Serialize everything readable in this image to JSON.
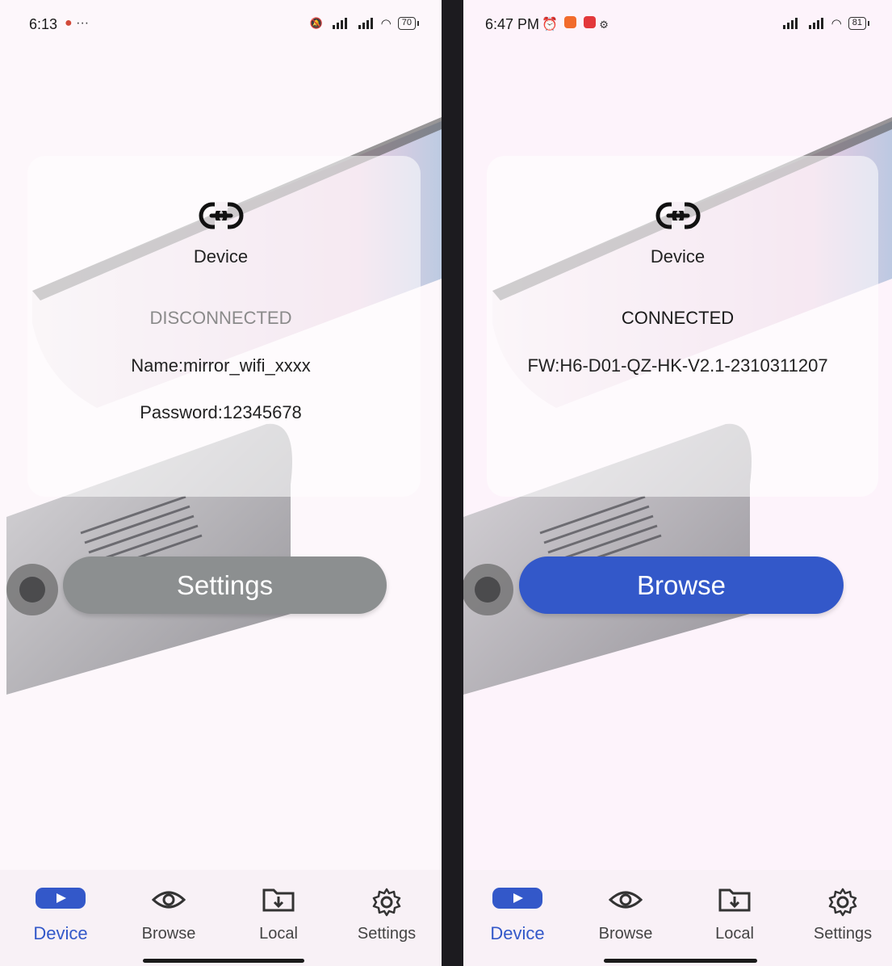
{
  "screens": [
    {
      "status_bar": {
        "time": "6:13",
        "extra": "···",
        "battery": "70"
      },
      "device": {
        "title": "Device",
        "status": "DISCONNECTED",
        "lines": [
          "Name:mirror_wifi_xxxx",
          "Password:12345678"
        ]
      },
      "action_button": "Settings",
      "nav": [
        {
          "label": "Device",
          "icon": "play-icon",
          "active": true
        },
        {
          "label": "Browse",
          "icon": "eye-icon",
          "active": false
        },
        {
          "label": "Local",
          "icon": "download-folder-icon",
          "active": false
        },
        {
          "label": "Settings",
          "icon": "gear-icon",
          "active": false
        }
      ]
    },
    {
      "status_bar": {
        "time": "6:47 PM",
        "battery": "81"
      },
      "device": {
        "title": "Device",
        "status": "CONNECTED",
        "lines": [
          "FW:H6-D01-QZ-HK-V2.1-2310311207"
        ]
      },
      "action_button": "Browse",
      "nav": [
        {
          "label": "Device",
          "icon": "play-icon",
          "active": true
        },
        {
          "label": "Browse",
          "icon": "eye-icon",
          "active": false
        },
        {
          "label": "Local",
          "icon": "download-folder-icon",
          "active": false
        },
        {
          "label": "Settings",
          "icon": "gear-icon",
          "active": false
        }
      ]
    }
  ],
  "colors": {
    "accent": "#3358c9",
    "disabled_button": "#8c8f90",
    "disconnected_text": "#8a8a8a",
    "connected_text": "#1a1a1a"
  }
}
